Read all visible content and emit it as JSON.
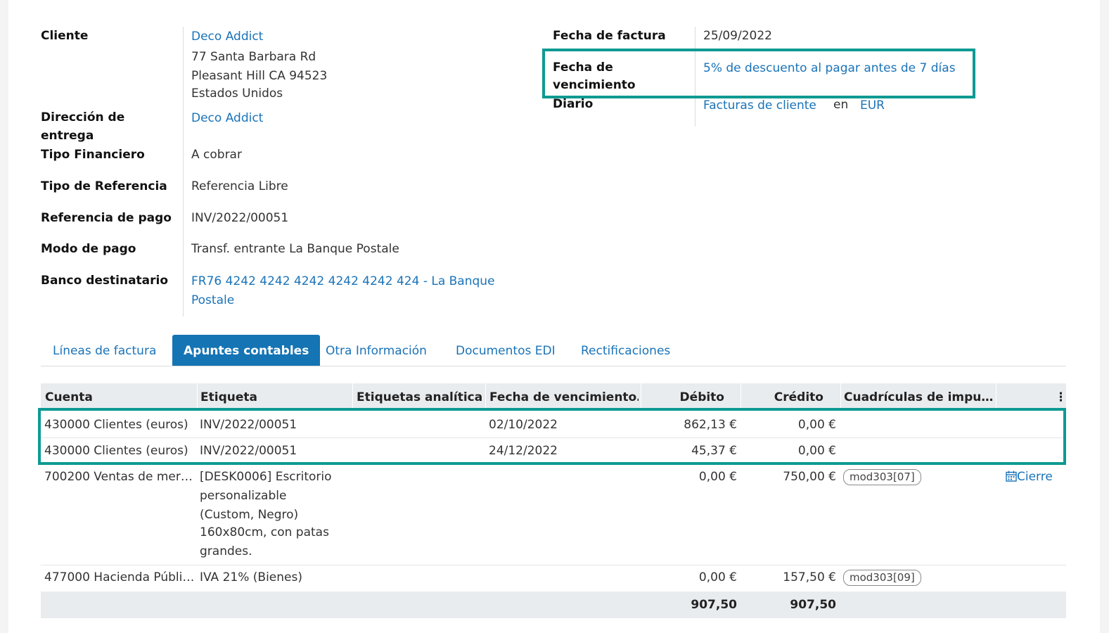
{
  "left_fields": {
    "cliente_label": "Cliente",
    "cliente_name": "Deco Addict",
    "address_line1": "77 Santa Barbara Rd",
    "address_line2": "Pleasant Hill CA 94523",
    "address_line3": "Estados Unidos",
    "entrega_label_1": "Dirección de",
    "entrega_label_2": "entrega",
    "entrega_value": "Deco Addict",
    "tipo_fin_label": "Tipo Financiero",
    "tipo_fin_value": "A cobrar",
    "tipo_ref_label": "Tipo de Referencia",
    "tipo_ref_value": "Referencia Libre",
    "ref_pago_label": "Referencia de pago",
    "ref_pago_value": "INV/2022/00051",
    "modo_pago_label": "Modo de pago",
    "modo_pago_value": "Transf. entrante La Banque Postale",
    "banco_label": "Banco destinatario",
    "banco_value_1": "FR76 4242 4242 4242 4242 4242 424 - La Banque",
    "banco_value_2": "Postale"
  },
  "right_fields": {
    "fecha_factura_label": "Fecha de factura",
    "fecha_factura_value": "25/09/2022",
    "venc_label_1": "Fecha de",
    "venc_label_2": "vencimiento",
    "venc_value": "5% de descuento al pagar antes de 7 días",
    "diario_label": "Diario",
    "diario_value": "Facturas de cliente",
    "diario_en": "en",
    "diario_currency": "EUR"
  },
  "tabs": [
    {
      "label": "Líneas de factura"
    },
    {
      "label": "Apuntes contables"
    },
    {
      "label": "Otra Información"
    },
    {
      "label": "Documentos EDI"
    },
    {
      "label": "Rectificaciones"
    }
  ],
  "table": {
    "headers": {
      "cuenta": "Cuenta",
      "etiqueta": "Etiqueta",
      "analiticas": "Etiquetas analíticas",
      "fecha_venc": "Fecha de vencimiento…",
      "debito": "Débito",
      "credito": "Crédito",
      "cuadriculas": "Cuadrículas de impu…"
    },
    "rows": [
      {
        "cuenta": "430000 Clientes (euros)",
        "etiqueta": "INV/2022/00051",
        "fecha": "02/10/2022",
        "debito": "862,13 €",
        "credito": "0,00 €"
      },
      {
        "cuenta": "430000 Clientes (euros)",
        "etiqueta": "INV/2022/00051",
        "fecha": "24/12/2022",
        "debito": "45,37 €",
        "credito": "0,00 €"
      },
      {
        "cuenta": "700200 Ventas de mer…",
        "etiqueta_lines": [
          "[DESK0006] Escritorio",
          "personalizable",
          "(Custom, Negro)",
          "160x80cm, con patas",
          "grandes."
        ],
        "debito": "0,00 €",
        "credito": "750,00 €",
        "tag": "mod303[07]",
        "action": "Cierre"
      },
      {
        "cuenta": "477000 Hacienda Públi…",
        "etiqueta": "IVA 21% (Bienes)",
        "debito": "0,00 €",
        "credito": "157,50 €",
        "tag": "mod303[09]"
      }
    ],
    "totals": {
      "debito": "907,50",
      "credito": "907,50"
    }
  },
  "colors": {
    "highlight": "#0e9a93",
    "link": "#1a73b8",
    "active_tab": "#1474b4"
  }
}
